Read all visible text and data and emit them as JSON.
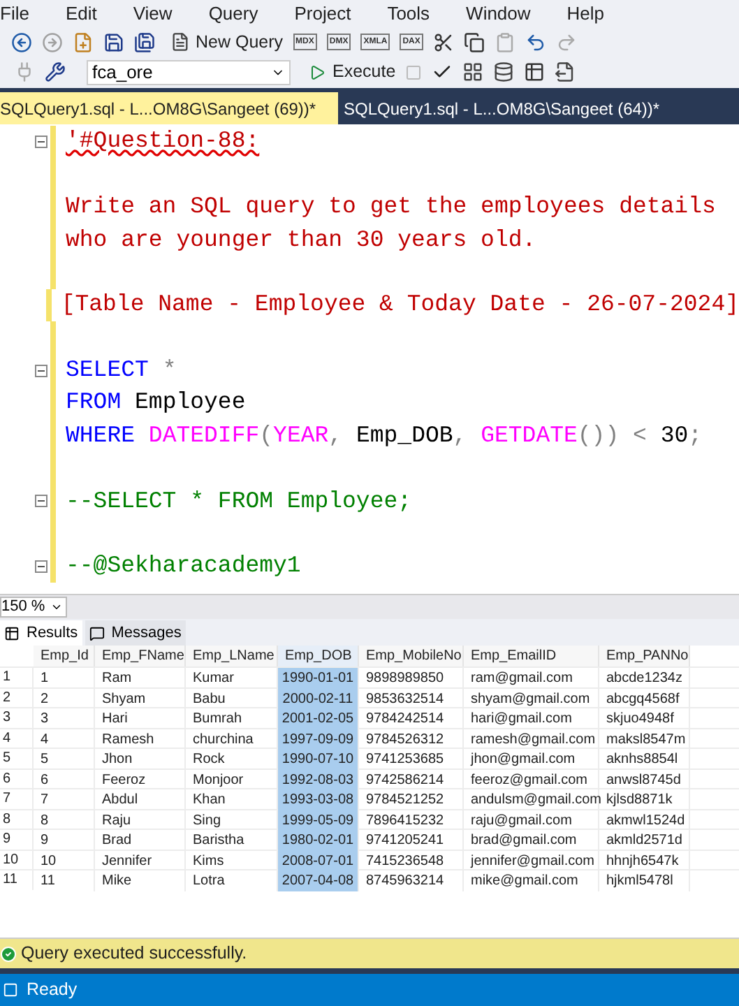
{
  "menu": [
    "File",
    "Edit",
    "View",
    "Query",
    "Project",
    "Tools",
    "Window",
    "Help"
  ],
  "toolbar": {
    "new_query": "New Query",
    "query_types": [
      "MDX",
      "DMX",
      "XMLA",
      "DAX"
    ],
    "database": "fca_ore",
    "execute": "Execute"
  },
  "tabs": [
    {
      "title": "SQLQuery1.sql - L...OM8G\\Sangeet (69))*",
      "selected": true
    },
    {
      "title": "SQLQuery1.sql - L...OM8G\\Sangeet (64))*",
      "selected": false
    }
  ],
  "editor": {
    "lines": [
      {
        "foldable": true,
        "tokens": [
          {
            "text": "'#Question-88:",
            "kind": "string",
            "squiggle": true
          }
        ]
      },
      {
        "foldable": false
      },
      {
        "foldable": false,
        "tokens": [
          {
            "text": "Write an SQL query to get the employees details",
            "kind": "string"
          }
        ]
      },
      {
        "foldable": false,
        "tokens": [
          {
            "text": "who are younger than 30 years old.",
            "kind": "string"
          }
        ]
      },
      {
        "foldable": false
      },
      {
        "foldable": false,
        "tokens": [
          {
            "text": "[Table Name - Employee & Today Date - 26-07-2024]",
            "kind": "string"
          }
        ]
      },
      {
        "foldable": false
      },
      {
        "foldable": true,
        "tokens": [
          {
            "text": "SELECT",
            "kind": "keyword"
          },
          {
            "text": " *",
            "kind": "operator"
          }
        ]
      },
      {
        "foldable": false,
        "tokens": [
          {
            "text": "FROM",
            "kind": "keyword"
          },
          {
            "text": " Employee",
            "kind": "plain"
          }
        ]
      },
      {
        "foldable": false,
        "tokens": [
          {
            "text": "WHERE",
            "kind": "keyword"
          },
          {
            "text": " DATEDIFF",
            "kind": "function"
          },
          {
            "text": "(",
            "kind": "operator"
          },
          {
            "text": "YEAR",
            "kind": "function"
          },
          {
            "text": ",",
            "kind": "operator"
          },
          {
            "text": " Emp_DOB",
            "kind": "plain"
          },
          {
            "text": ",",
            "kind": "operator"
          },
          {
            "text": " GETDATE",
            "kind": "function"
          },
          {
            "text": "()) <",
            "kind": "operator"
          },
          {
            "text": " 30",
            "kind": "plain"
          },
          {
            "text": ";",
            "kind": "operator"
          }
        ]
      },
      {
        "foldable": false
      },
      {
        "foldable": true,
        "tokens": [
          {
            "text": "--SELECT * FROM Employee;",
            "kind": "comment"
          }
        ]
      },
      {
        "foldable": false
      },
      {
        "foldable": true,
        "tokens": [
          {
            "text": "--@Sekharacademy1",
            "kind": "comment"
          }
        ]
      }
    ]
  },
  "zoom": "150 %",
  "result_tabs": [
    {
      "label": "Results",
      "selected": true
    },
    {
      "label": "Messages",
      "selected": false
    }
  ],
  "grid": {
    "columns": [
      {
        "label": "Emp_Id",
        "selected": false
      },
      {
        "label": "Emp_FName",
        "selected": false
      },
      {
        "label": "Emp_LName",
        "selected": false
      },
      {
        "label": "Emp_DOB",
        "selected": true
      },
      {
        "label": "Emp_MobileNo",
        "selected": false
      },
      {
        "label": "Emp_EmailID",
        "selected": false
      },
      {
        "label": "Emp_PANNo",
        "selected": false
      }
    ],
    "rows": [
      {
        "number": "1",
        "cells": [
          "1",
          "Ram",
          "Kumar",
          "1990-01-01",
          "9898989850",
          "ram@gmail.com",
          "abcde1234z"
        ]
      },
      {
        "number": "2",
        "cells": [
          "2",
          "Shyam",
          "Babu",
          "2000-02-11",
          "9853632514",
          "shyam@gmail.com",
          "abcgq4568f"
        ]
      },
      {
        "number": "3",
        "cells": [
          "3",
          "Hari",
          "Bumrah",
          "2001-02-05",
          "9784242514",
          "hari@gmail.com",
          "skjuo4948f"
        ]
      },
      {
        "number": "4",
        "cells": [
          "4",
          "Ramesh",
          "churchina",
          "1997-09-09",
          "9784526312",
          "ramesh@gmail.com",
          "maksl8547m"
        ]
      },
      {
        "number": "5",
        "cells": [
          "5",
          "Jhon",
          "Rock",
          "1990-07-10",
          "9741253685",
          "jhon@gmail.com",
          "aknhs8854l"
        ]
      },
      {
        "number": "6",
        "cells": [
          "6",
          "Feeroz",
          "Monjoor",
          "1992-08-03",
          "9742586214",
          "feeroz@gmail.com",
          "anwsl8745d"
        ]
      },
      {
        "number": "7",
        "cells": [
          "7",
          "Abdul",
          "Khan",
          "1993-03-08",
          "9784521252",
          "andulsm@gmail.com",
          "kjlsd8871k"
        ]
      },
      {
        "number": "8",
        "cells": [
          "8",
          "Raju",
          "Sing",
          "1999-05-09",
          "7896415232",
          "raju@gmail.com",
          "akmwl1524d"
        ]
      },
      {
        "number": "9",
        "cells": [
          "9",
          "Brad",
          "Baristha",
          "1980-02-01",
          "9741205241",
          "brad@gmail.com",
          "akmld2571d"
        ]
      },
      {
        "number": "10",
        "cells": [
          "10",
          "Jennifer",
          "Kims",
          "2008-07-01",
          "7415236548",
          "jennifer@gmail.com",
          "hhnjh6547k"
        ]
      },
      {
        "number": "11",
        "cells": [
          "11",
          "Mike",
          "Lotra",
          "2007-04-08",
          "8745963214",
          "mike@gmail.com",
          "hjkml5478l"
        ]
      }
    ]
  },
  "status": "Query executed successfully.",
  "ready": "Ready"
}
